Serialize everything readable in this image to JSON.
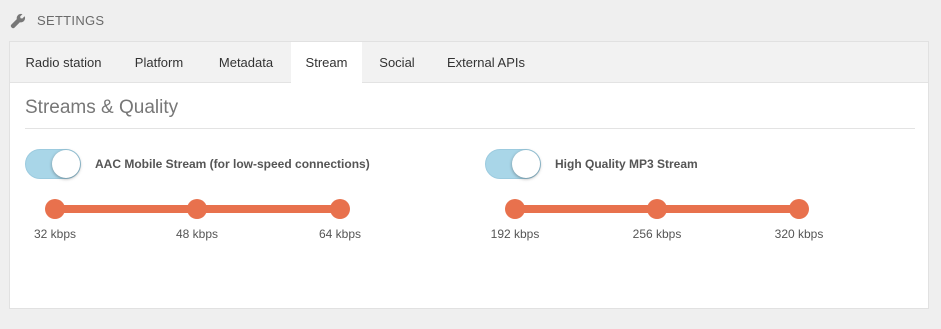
{
  "header": {
    "icon": "wrench-icon",
    "title": "SETTINGS"
  },
  "tabs": [
    {
      "label": "Radio station",
      "active": false
    },
    {
      "label": "Platform",
      "active": false
    },
    {
      "label": "Metadata",
      "active": false
    },
    {
      "label": "Stream",
      "active": true
    },
    {
      "label": "Social",
      "active": false
    },
    {
      "label": "External APIs",
      "active": false
    }
  ],
  "section": {
    "title": "Streams & Quality"
  },
  "streams": [
    {
      "label": "AAC Mobile Stream (for low-speed connections)",
      "enabled": true,
      "options": [
        "32 kbps",
        "48 kbps",
        "64 kbps"
      ]
    },
    {
      "label": "High Quality MP3 Stream",
      "enabled": true,
      "options": [
        "192 kbps",
        "256 kbps",
        "320 kbps"
      ]
    }
  ],
  "colors": {
    "accent": "#e8714d",
    "toggle_on": "#a9d6e8"
  }
}
